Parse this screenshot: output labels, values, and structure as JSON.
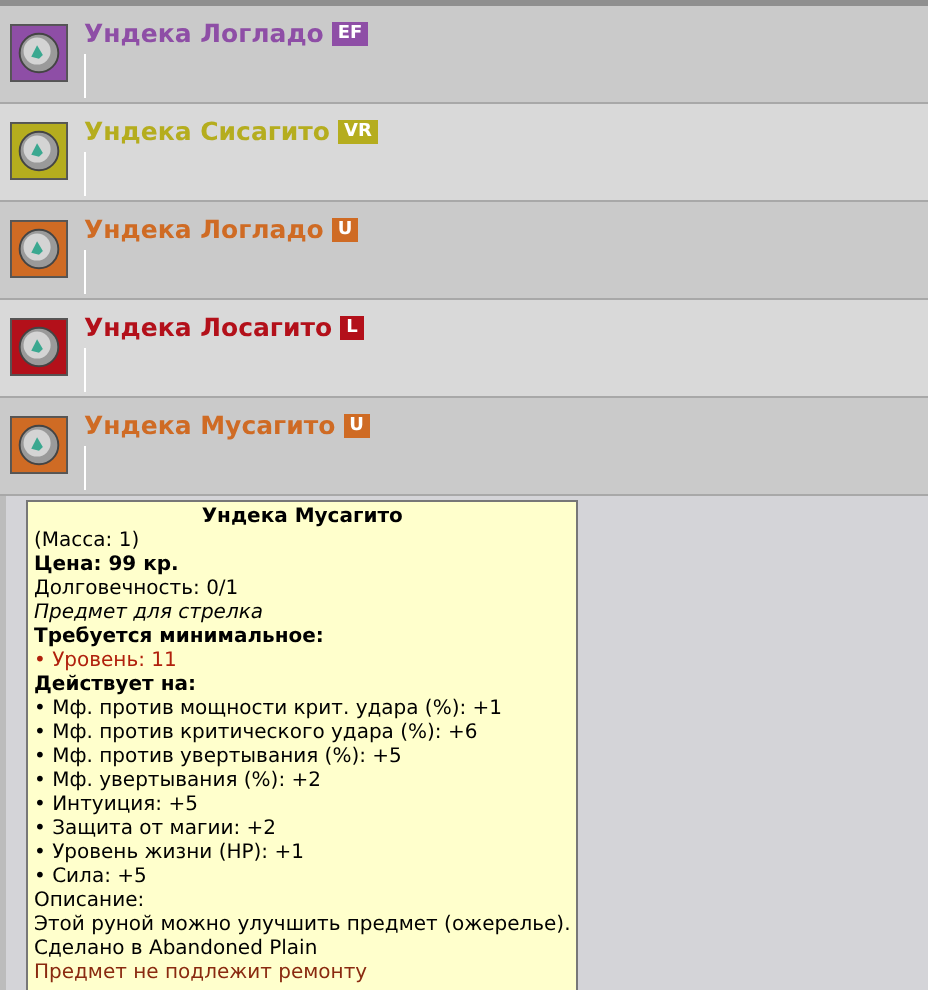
{
  "items": [
    {
      "name": "Ундека Логладо",
      "tag": "EF",
      "color": "#8e4ea6"
    },
    {
      "name": "Ундека Сисагито",
      "tag": "VR",
      "color": "#b5ad1e"
    },
    {
      "name": "Ундека Логладо",
      "tag": "U",
      "color": "#cf6b24"
    },
    {
      "name": "Ундека Лосагито",
      "tag": "L",
      "color": "#b3101a"
    },
    {
      "name": "Ундека Мусагито",
      "tag": "U",
      "color": "#cf6b24"
    }
  ],
  "tooltip": {
    "title": "Ундека Мусагито",
    "lines": [
      {
        "kind": "plain",
        "text": "(Масса: 1)"
      },
      {
        "kind": "bold",
        "text": "Цена: 99 кр."
      },
      {
        "kind": "plain",
        "text": "Долговечность: 0/1"
      },
      {
        "kind": "italic",
        "text": "Предмет для стрелка"
      },
      {
        "kind": "bold",
        "text": "Требуется минимальное:"
      },
      {
        "kind": "warning",
        "text": "• Уровень: 11"
      },
      {
        "kind": "bold",
        "text": "Действует на:"
      },
      {
        "kind": "plain",
        "text": "• Мф. против мощности крит. удара (%): +1"
      },
      {
        "kind": "plain",
        "text": "• Мф. против критического удара (%): +6"
      },
      {
        "kind": "plain",
        "text": "• Мф. против увертывания (%): +5"
      },
      {
        "kind": "plain",
        "text": "• Мф. увертывания (%): +2"
      },
      {
        "kind": "plain",
        "text": "• Интуиция: +5"
      },
      {
        "kind": "plain",
        "text": "• Защита от магии: +2"
      },
      {
        "kind": "plain",
        "text": "• Уровень жизни (HP): +1"
      },
      {
        "kind": "plain",
        "text": "• Сила: +5"
      },
      {
        "kind": "plain",
        "text": "Описание:"
      },
      {
        "kind": "plain",
        "text": "Этой руной можно улучшить предмет (ожерелье)."
      },
      {
        "kind": "plain",
        "text": "Сделано в Abandoned Plain"
      },
      {
        "kind": "note",
        "text": "Предмет не подлежит ремонту"
      }
    ]
  }
}
